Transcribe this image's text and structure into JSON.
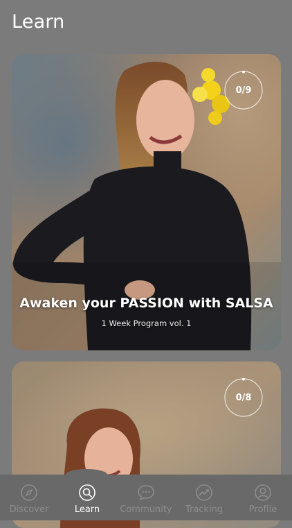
{
  "header": {
    "title": "Learn"
  },
  "cards": [
    {
      "progress_text": "0/9",
      "progress_value": 0,
      "title": "Awaken your PASSION with SALSA",
      "subtitle": "1 Week Program vol. 1"
    },
    {
      "progress_text": "0/8",
      "progress_value": 0
    }
  ],
  "tabbar": {
    "items": [
      {
        "label": "Discover",
        "icon": "compass-icon",
        "active": false
      },
      {
        "label": "Learn",
        "icon": "search-icon",
        "active": true
      },
      {
        "label": "Community",
        "icon": "chat-bubble-icon",
        "active": false
      },
      {
        "label": "Tracking",
        "icon": "trend-icon",
        "active": false
      },
      {
        "label": "Profile",
        "icon": "user-icon",
        "active": false
      }
    ]
  },
  "colors": {
    "background": "#7b7b7b",
    "tabbar": "#696969",
    "active_label": "#ffffff",
    "inactive_label": "#8d8d8d"
  }
}
